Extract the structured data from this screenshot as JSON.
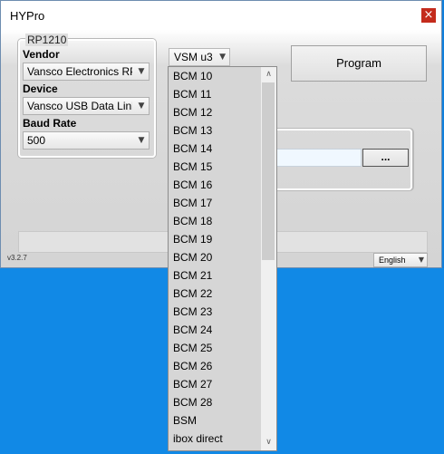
{
  "window": {
    "title": "HYPro",
    "close_glyph": "×"
  },
  "rp1210": {
    "legend": "RP1210",
    "vendor_label": "Vendor",
    "vendor_value": "Vansco Electronics RP",
    "device_label": "Device",
    "device_value": "Vansco USB Data Link",
    "baud_label": "Baud Rate",
    "baud_value": "500"
  },
  "vsm": {
    "selected": "VSM u3"
  },
  "program_button": "Program",
  "browse_button": "...",
  "version": "v3.2.7",
  "language": {
    "selected": "English"
  },
  "dropdown": {
    "items": [
      "BCM 10",
      "BCM 11",
      "BCM 12",
      "BCM 13",
      "BCM 14",
      "BCM 15",
      "BCM 16",
      "BCM 17",
      "BCM 18",
      "BCM 19",
      "BCM 20",
      "BCM 21",
      "BCM 22",
      "BCM 23",
      "BCM 24",
      "BCM 25",
      "BCM 26",
      "BCM 27",
      "BCM 28",
      "BSM",
      "ibox direct"
    ]
  },
  "icons": {
    "combo_arrow": "chevron-down-icon",
    "scroll_up": "chevron-up-icon",
    "scroll_down": "chevron-down-icon"
  },
  "colors": {
    "desktop": "#0f7fdc",
    "close": "#c42b1c",
    "dropdown_bg": "#d6d6d6"
  }
}
